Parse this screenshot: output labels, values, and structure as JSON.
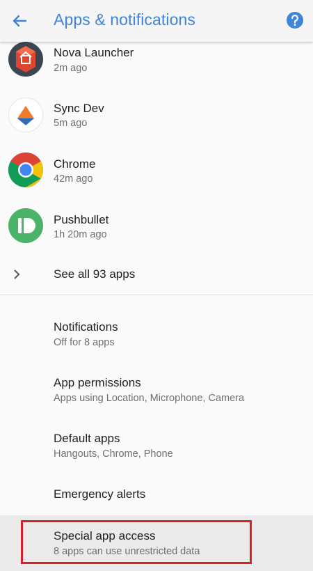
{
  "appbar": {
    "title": "Apps & notifications",
    "back_icon": "arrow-back-icon",
    "help_icon": "help-icon",
    "accent_color": "#3f84d6"
  },
  "recent_apps": [
    {
      "name": "Nova Launcher",
      "time": "2m ago",
      "icon": "nova-launcher-icon"
    },
    {
      "name": "Sync Dev",
      "time": "5m ago",
      "icon": "sync-dev-icon"
    },
    {
      "name": "Chrome",
      "time": "42m ago",
      "icon": "chrome-icon"
    },
    {
      "name": "Pushbullet",
      "time": "1h 20m ago",
      "icon": "pushbullet-icon"
    }
  ],
  "see_all": {
    "label": "See all 93 apps",
    "icon": "chevron-right-icon"
  },
  "settings": [
    {
      "title": "Notifications",
      "subtitle": "Off for 8 apps"
    },
    {
      "title": "App permissions",
      "subtitle": "Apps using Location, Microphone, Camera"
    },
    {
      "title": "Default apps",
      "subtitle": "Hangouts, Chrome, Phone"
    },
    {
      "title": "Emergency alerts",
      "subtitle": ""
    },
    {
      "title": "Special app access",
      "subtitle": "8 apps can use unrestricted data"
    }
  ],
  "highlight_color": "#d8202a"
}
